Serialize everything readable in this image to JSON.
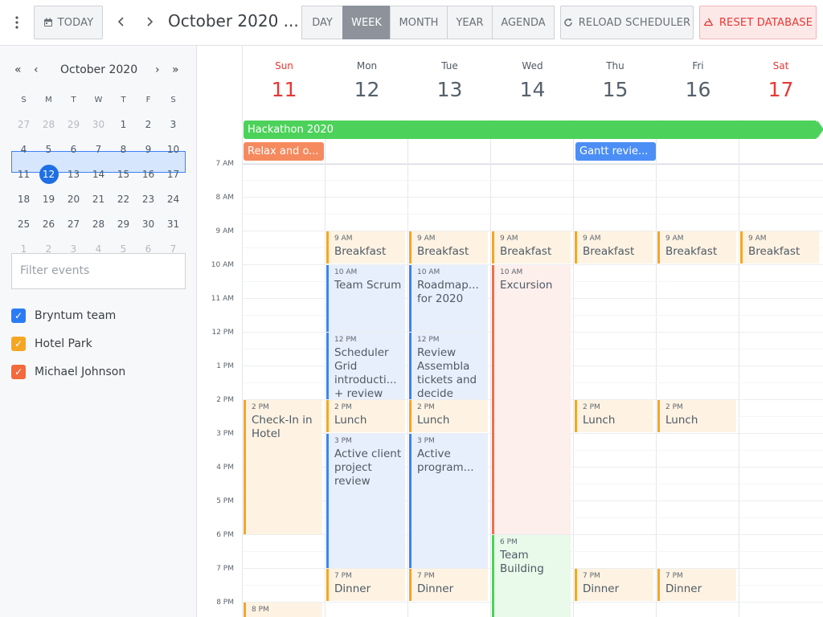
{
  "toolbar": {
    "menu_icon": "vertical-dots-icon",
    "today_label": "TODAY",
    "title": "October 2020 ...",
    "views": [
      "DAY",
      "WEEK",
      "MONTH",
      "YEAR",
      "AGENDA"
    ],
    "active_view": "WEEK",
    "reload_label": "RELOAD SCHEDULER",
    "reset_label": "RESET DATABASE"
  },
  "mini_cal": {
    "month_label": "October 2020",
    "day_names": [
      "S",
      "M",
      "T",
      "W",
      "T",
      "F",
      "S"
    ],
    "weeks": [
      [
        "27",
        "28",
        "29",
        "30",
        "1",
        "2",
        "3"
      ],
      [
        "4",
        "5",
        "6",
        "7",
        "8",
        "9",
        "10"
      ],
      [
        "11",
        "12",
        "13",
        "14",
        "15",
        "16",
        "17"
      ],
      [
        "18",
        "19",
        "20",
        "21",
        "22",
        "23",
        "24"
      ],
      [
        "25",
        "26",
        "27",
        "28",
        "29",
        "30",
        "31"
      ],
      [
        "1",
        "2",
        "3",
        "4",
        "5",
        "6",
        "7"
      ]
    ],
    "today": "12"
  },
  "filter": {
    "placeholder": "Filter events"
  },
  "resources": [
    {
      "name": "Bryntum team",
      "color": "#2b7cf4"
    },
    {
      "name": "Hotel Park",
      "color": "#f5a623"
    },
    {
      "name": "Michael Johnson",
      "color": "#f26a3d"
    }
  ],
  "days": [
    {
      "name": "Sun",
      "date": "11"
    },
    {
      "name": "Mon",
      "date": "12"
    },
    {
      "name": "Tue",
      "date": "13"
    },
    {
      "name": "Wed",
      "date": "14"
    },
    {
      "name": "Thu",
      "date": "15"
    },
    {
      "name": "Fri",
      "date": "16"
    },
    {
      "name": "Sat",
      "date": "17"
    }
  ],
  "all_day_events": [
    {
      "name": "Hackathon 2020",
      "color": "#4cd25a"
    },
    {
      "name": "Relax and o...",
      "color": "#f58a5f"
    },
    {
      "name": "Gantt revie...",
      "color": "#4b8ef5"
    }
  ],
  "time_labels": [
    "7 AM",
    "8 AM",
    "9 AM",
    "10 AM",
    "11 AM",
    "12 PM",
    "1 PM",
    "2 PM",
    "3 PM",
    "4 PM",
    "5 PM",
    "6 PM",
    "7 PM",
    "8 PM"
  ],
  "events": [
    {
      "time": "9 AM",
      "name": "Breakfast"
    },
    {
      "time": "9 AM",
      "name": "Breakfast"
    },
    {
      "time": "9 AM",
      "name": "Breakfast"
    },
    {
      "time": "9 AM",
      "name": "Breakfast"
    },
    {
      "time": "9 AM",
      "name": "Breakfast"
    },
    {
      "time": "9 AM",
      "name": "Breakfast"
    },
    {
      "time": "10 AM",
      "name": "Team Scrum"
    },
    {
      "time": "10 AM",
      "name": "Roadmap... for 2020"
    },
    {
      "time": "10 AM",
      "name": "Excursion"
    },
    {
      "time": "12 PM",
      "name": "Scheduler Grid introducti... + review"
    },
    {
      "time": "12 PM",
      "name": "Review Assembla tickets and decide"
    },
    {
      "time": "2 PM",
      "name": "Check-In in Hotel"
    },
    {
      "time": "2 PM",
      "name": "Lunch"
    },
    {
      "time": "2 PM",
      "name": "Lunch"
    },
    {
      "time": "2 PM",
      "name": "Lunch"
    },
    {
      "time": "2 PM",
      "name": "Lunch"
    },
    {
      "time": "3 PM",
      "name": "Active client project review"
    },
    {
      "time": "3 PM",
      "name": "Active program..."
    },
    {
      "time": "6 PM",
      "name": "Team Building"
    },
    {
      "time": "7 PM",
      "name": "Dinner"
    },
    {
      "time": "7 PM",
      "name": "Dinner"
    },
    {
      "time": "7 PM",
      "name": "Dinner"
    },
    {
      "time": "7 PM",
      "name": "Dinner"
    },
    {
      "time": "8 PM",
      "name": ""
    }
  ]
}
